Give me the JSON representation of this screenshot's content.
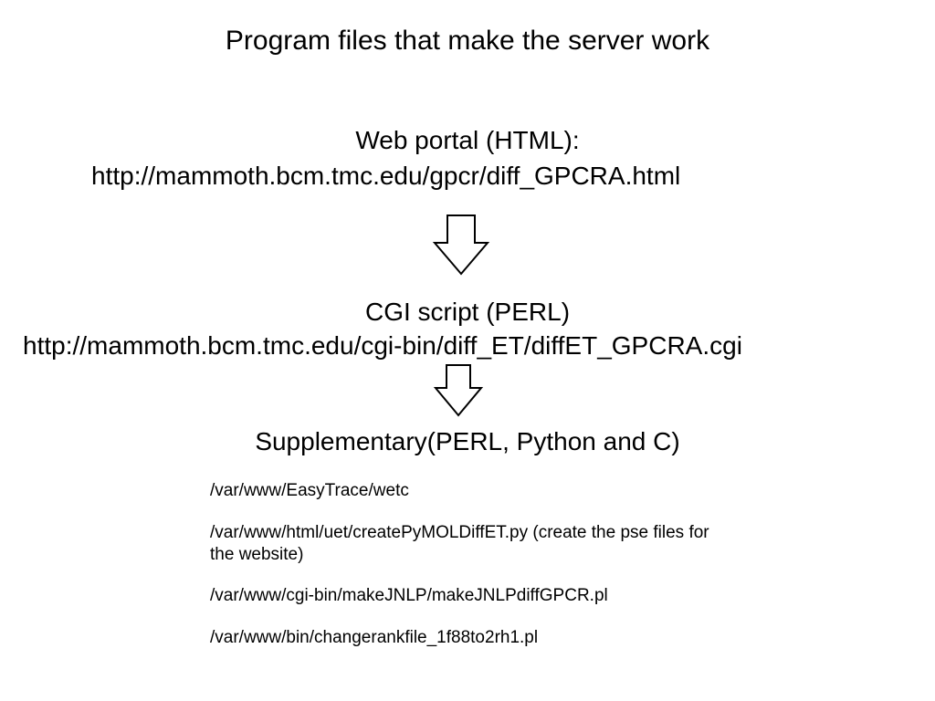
{
  "title": "Program files that make the server work",
  "portal": {
    "heading": "Web portal (HTML):",
    "url": "http://mammoth.bcm.tmc.edu/gpcr/diff_GPCRA.html"
  },
  "cgi": {
    "heading": "CGI script (PERL)",
    "url": "http://mammoth.bcm.tmc.edu/cgi-bin/diff_ET/diffET_GPCRA.cgi"
  },
  "supplementary": {
    "heading": "Supplementary(PERL, Python and C)",
    "files": {
      "f0": "/var/www/EasyTrace/wetc",
      "f1": "/var/www/html/uet/createPyMOLDiffET.py (create the pse files for the website)",
      "f2": "/var/www/cgi-bin/makeJNLP/makeJNLPdiffGPCR.pl",
      "f3": "/var/www/bin/changerankfile_1f88to2rh1.pl"
    }
  }
}
